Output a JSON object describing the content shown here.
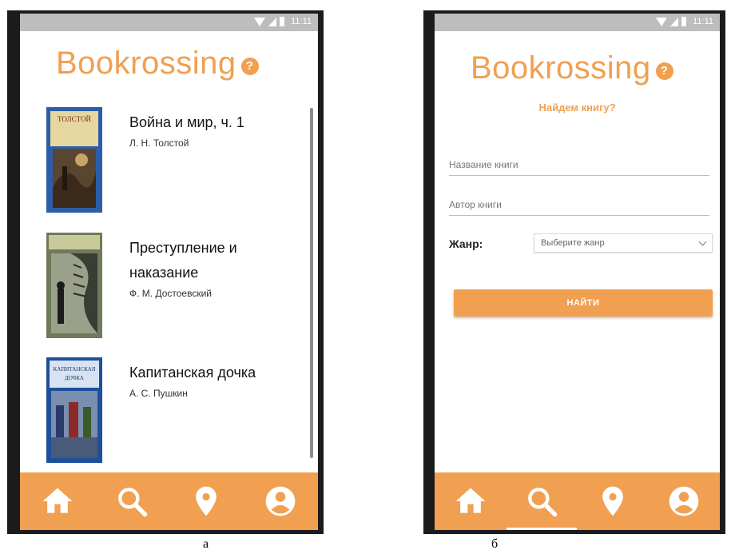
{
  "screens": [
    {
      "status": {
        "time": "11:11"
      },
      "logo": {
        "text": "Bookrossing",
        "help_icon": "help-circle-icon"
      },
      "books": [
        {
          "title": "Война и мир, ч. 1",
          "author": "Л. Н. Толстой",
          "cover_text": [
            "ТОЛСТОЙ"
          ]
        },
        {
          "title": "Преступление и наказание",
          "author": "Ф. М. Достоевский",
          "cover_text": []
        },
        {
          "title": "Капитанская дочка",
          "author": "А. С. Пушкин",
          "cover_text": [
            "КАПИТАНСКАЯ",
            "ДОЧКА"
          ]
        }
      ],
      "nav": [
        "home-icon",
        "search-icon",
        "location-icon",
        "profile-icon"
      ],
      "active_nav": "home",
      "caption": "а"
    },
    {
      "status": {
        "time": "11:11"
      },
      "logo": {
        "text": "Bookrossing",
        "help_icon": "help-circle-icon"
      },
      "subtitle": "Найдем книгу?",
      "fields": {
        "book_name_placeholder": "Название книги",
        "author_placeholder": "Автор книги"
      },
      "genre": {
        "label": "Жанр:",
        "selected": "Выберите жанр"
      },
      "find_button": "НАЙТИ",
      "nav": [
        "home-icon",
        "search-icon",
        "location-icon",
        "profile-icon"
      ],
      "active_nav": "search",
      "caption": "б"
    }
  ],
  "colors": {
    "accent": "#f0a050",
    "statusbar": "#bdbdbd",
    "phone_frame": "#1b1b1b"
  }
}
